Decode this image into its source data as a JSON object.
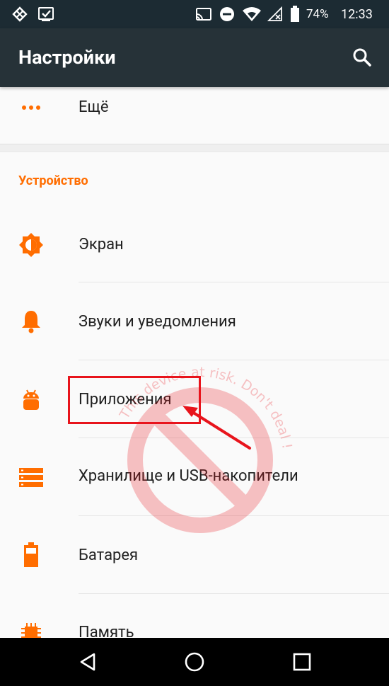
{
  "status_bar": {
    "battery_percent": "74%",
    "time": "12:33"
  },
  "app_bar": {
    "title": "Настройки"
  },
  "list": {
    "more_label": "Ещё",
    "section_device": "Устройство",
    "items": [
      {
        "label": "Экран"
      },
      {
        "label": "Звуки и уведомления"
      },
      {
        "label": "Приложения"
      },
      {
        "label": "Хранилище и USB-накопители"
      },
      {
        "label": "Батарея"
      },
      {
        "label": "Память"
      }
    ]
  },
  "watermark": {
    "text": "This device at risk. Don't deal !"
  },
  "colors": {
    "accent": "#ff6d00",
    "toolbar": "#263238",
    "status_bar": "#1c2b33",
    "highlight": "#e8141c"
  }
}
